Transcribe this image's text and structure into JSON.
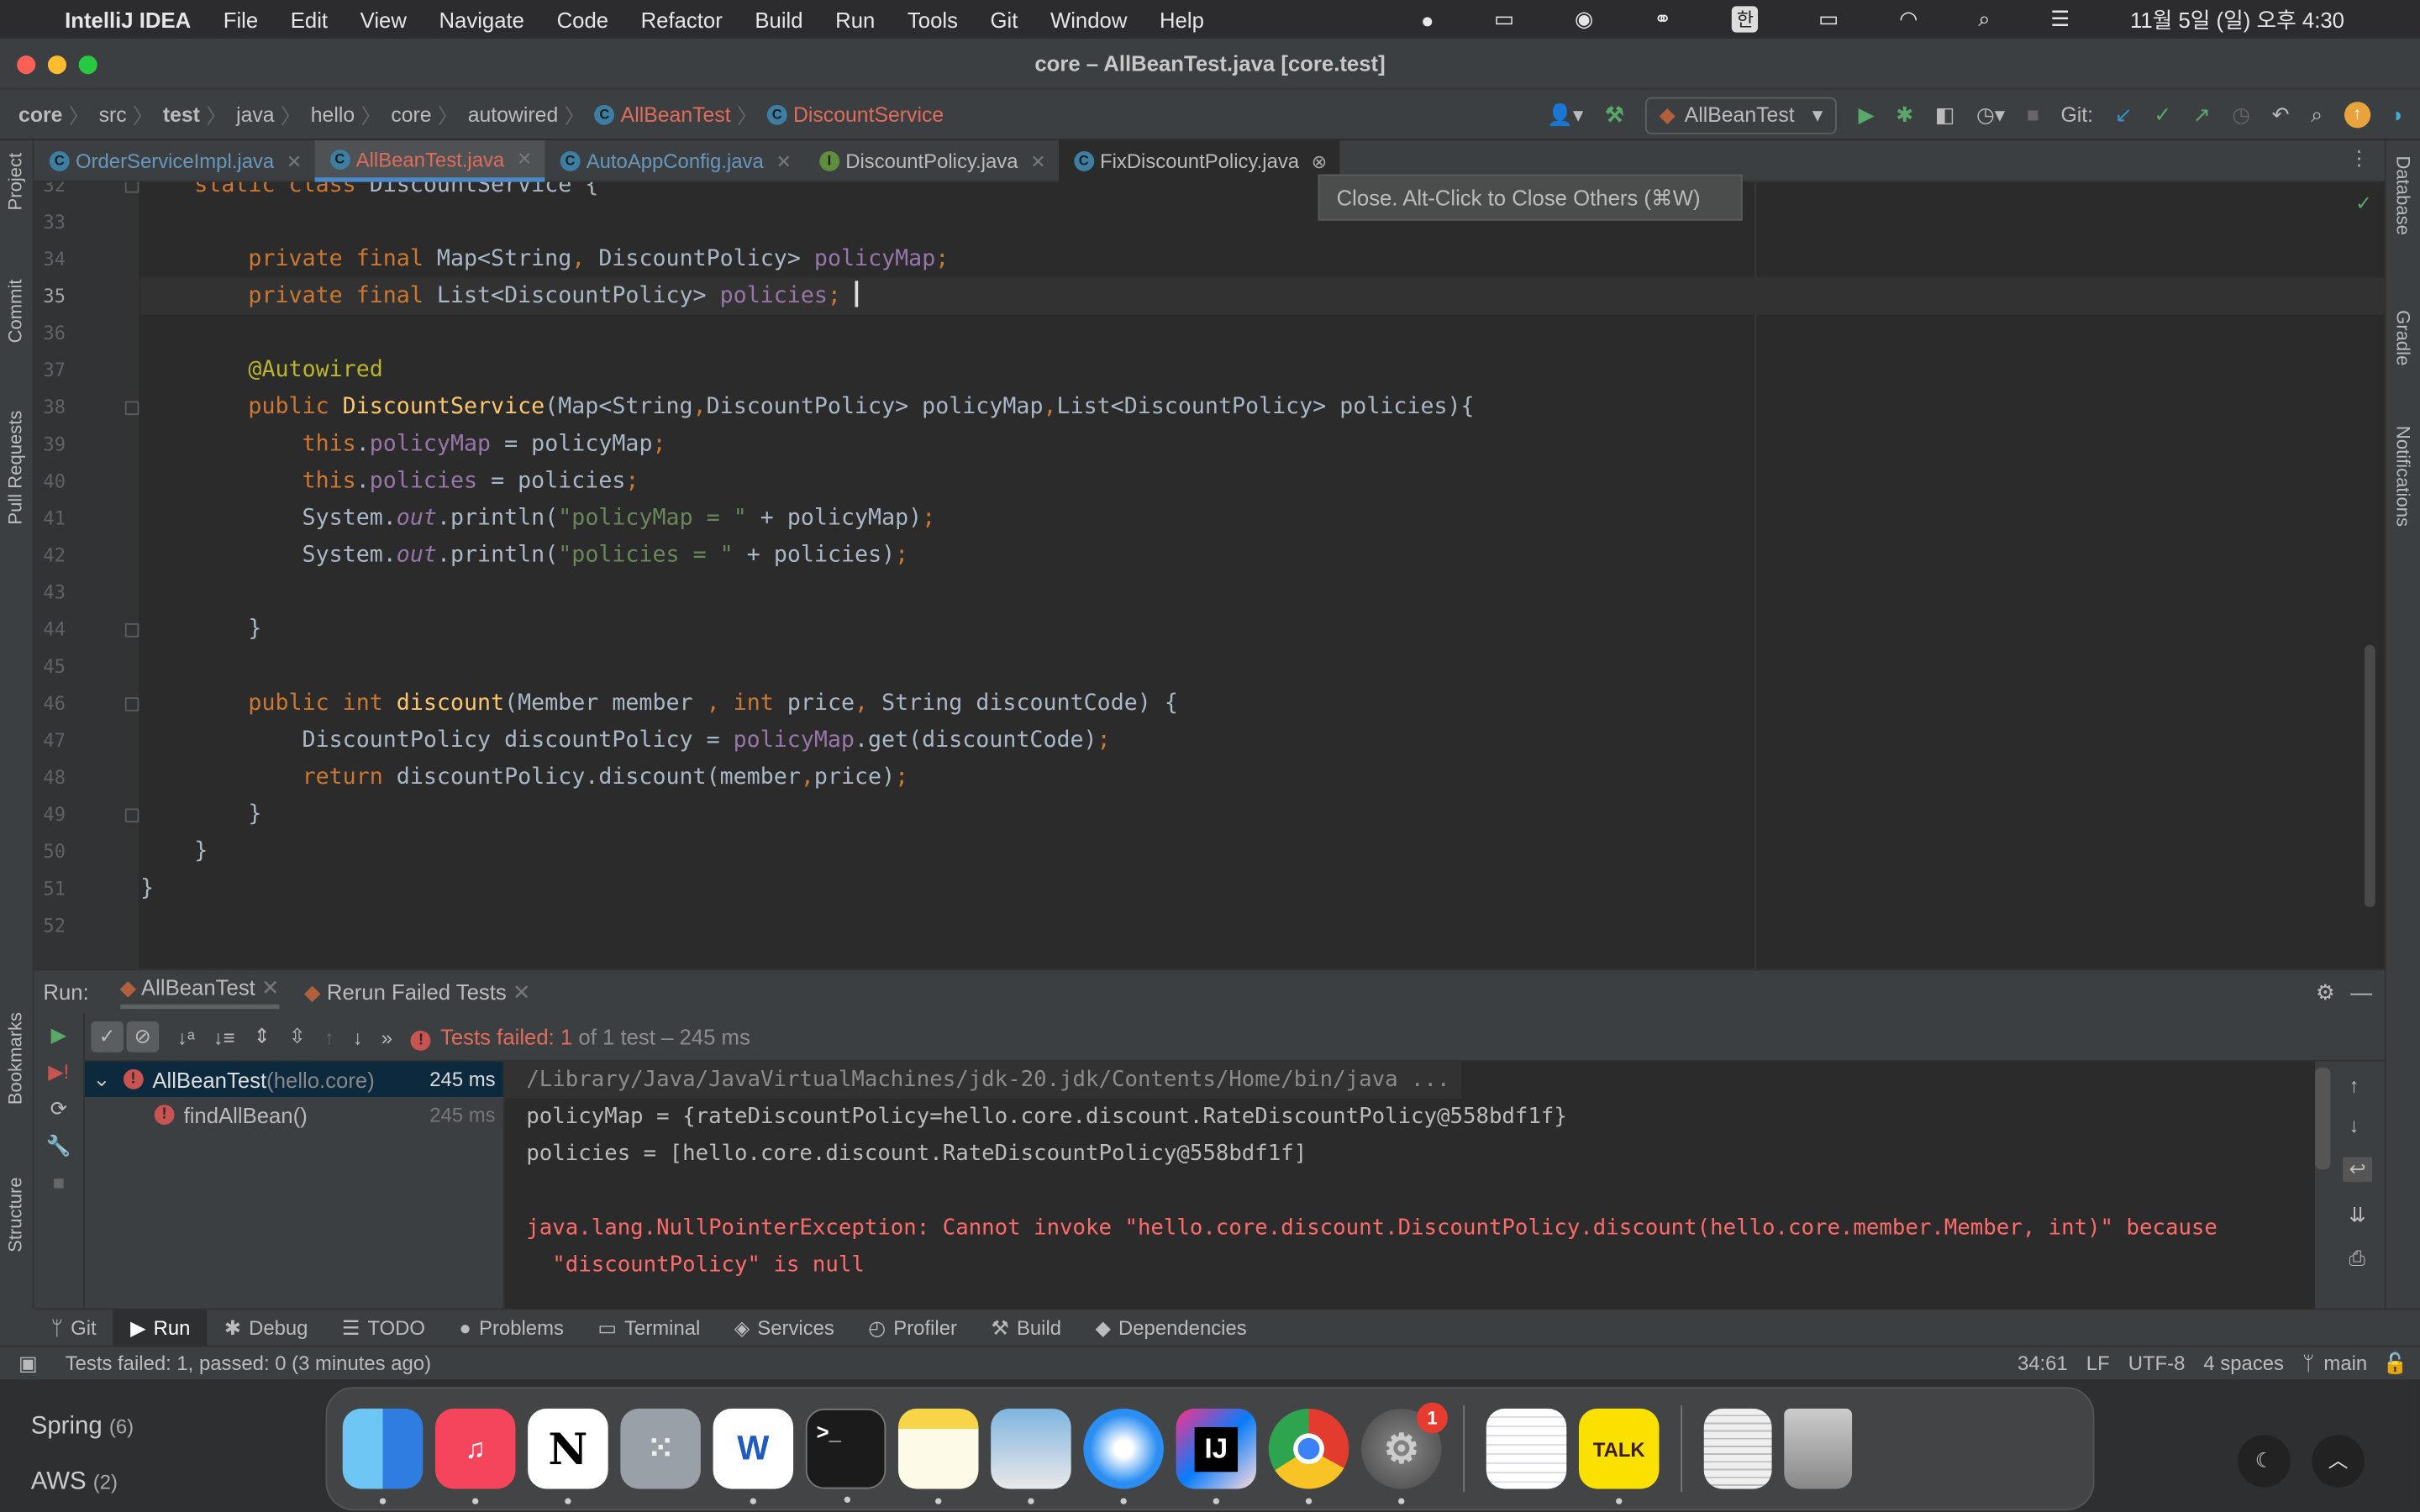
{
  "menubar": {
    "app": "IntelliJ IDEA",
    "items": [
      "File",
      "Edit",
      "View",
      "Navigate",
      "Code",
      "Refactor",
      "Build",
      "Run",
      "Tools",
      "Git",
      "Window",
      "Help"
    ],
    "ime": "한",
    "clock": "11월 5일 (일) 오후 4:30"
  },
  "window": {
    "title": "core – AllBeanTest.java [core.test]"
  },
  "breadcrumb": [
    "core",
    "src",
    "test",
    "java",
    "hello",
    "core",
    "autowired",
    "AllBeanTest",
    "DiscountService"
  ],
  "toolbar": {
    "run_config": "AllBeanTest",
    "git_label": "Git:"
  },
  "tabs": [
    {
      "label": "OrderServiceImpl.java",
      "icon": "class-icon"
    },
    {
      "label": "AllBeanTest.java",
      "icon": "class-icon",
      "active": true
    },
    {
      "label": "AutoAppConfig.java",
      "icon": "class-icon"
    },
    {
      "label": "DiscountPolicy.java",
      "icon": "interface-icon"
    },
    {
      "label": "FixDiscountPolicy.java",
      "icon": "class-icon"
    }
  ],
  "tooltip": "Close. Alt-Click to Close Others (⌘W)",
  "left_tools": [
    "Project",
    "Commit",
    "Pull Requests",
    "Bookmarks",
    "Structure"
  ],
  "right_tools": [
    "Database",
    "Gradle",
    "Notifications"
  ],
  "editor": {
    "current_line": 35,
    "lines": [
      {
        "n": 32,
        "t": [
          [
            "    "
          ],
          [
            "static class ",
            "k"
          ],
          [
            "DiscountService {"
          ]
        ]
      },
      {
        "n": 33,
        "t": []
      },
      {
        "n": 34,
        "t": [
          [
            "        "
          ],
          [
            "private final ",
            "k"
          ],
          [
            "Map<String"
          ],
          [
            ", ",
            "k"
          ],
          [
            "DiscountPolicy> "
          ],
          [
            "policyMap",
            "f"
          ],
          [
            ";",
            "k"
          ]
        ]
      },
      {
        "n": 35,
        "t": [
          [
            "        "
          ],
          [
            "private final ",
            "k"
          ],
          [
            "List<DiscountPolicy> "
          ],
          [
            "policies",
            "f"
          ],
          [
            ";",
            "k"
          ],
          [
            " "
          ]
        ]
      },
      {
        "n": 36,
        "t": []
      },
      {
        "n": 37,
        "t": [
          [
            "        "
          ],
          [
            "@Autowired",
            "a"
          ]
        ]
      },
      {
        "n": 38,
        "t": [
          [
            "        "
          ],
          [
            "public ",
            "k"
          ],
          [
            "DiscountService",
            "m"
          ],
          [
            "(Map<String"
          ],
          [
            ",",
            "k"
          ],
          [
            "DiscountPolicy> policyMap"
          ],
          [
            ",",
            "k"
          ],
          [
            "List<DiscountPolicy> policies){"
          ]
        ]
      },
      {
        "n": 39,
        "t": [
          [
            "            "
          ],
          [
            "this",
            "k"
          ],
          [
            "."
          ],
          [
            "policyMap",
            "f"
          ],
          [
            " = policyMap"
          ],
          [
            ";",
            "k"
          ]
        ]
      },
      {
        "n": 40,
        "t": [
          [
            "            "
          ],
          [
            "this",
            "k"
          ],
          [
            "."
          ],
          [
            "policies",
            "f"
          ],
          [
            " = policies"
          ],
          [
            ";",
            "k"
          ]
        ]
      },
      {
        "n": 41,
        "t": [
          [
            "            System."
          ],
          [
            "out",
            "o"
          ],
          [
            ".println("
          ],
          [
            "\"policyMap = \"",
            "s"
          ],
          [
            " + policyMap)"
          ],
          [
            ";",
            "k"
          ]
        ]
      },
      {
        "n": 42,
        "t": [
          [
            "            System."
          ],
          [
            "out",
            "o"
          ],
          [
            ".println("
          ],
          [
            "\"policies = \"",
            "s"
          ],
          [
            " + policies)"
          ],
          [
            ";",
            "k"
          ]
        ]
      },
      {
        "n": 43,
        "t": []
      },
      {
        "n": 44,
        "t": [
          [
            "        }"
          ]
        ]
      },
      {
        "n": 45,
        "t": []
      },
      {
        "n": 46,
        "t": [
          [
            "        "
          ],
          [
            "public int ",
            "k"
          ],
          [
            "discount",
            "m"
          ],
          [
            "(Member member "
          ],
          [
            ", ",
            "k"
          ],
          [
            "int ",
            "k"
          ],
          [
            "price"
          ],
          [
            ", ",
            "k"
          ],
          [
            "String discountCode) {"
          ]
        ]
      },
      {
        "n": 47,
        "t": [
          [
            "            DiscountPolicy discountPolicy = "
          ],
          [
            "policyMap",
            "f"
          ],
          [
            ".get(discountCode)"
          ],
          [
            ";",
            "k"
          ]
        ]
      },
      {
        "n": 48,
        "t": [
          [
            "            "
          ],
          [
            "return ",
            "k"
          ],
          [
            "discountPolicy.discount(member"
          ],
          [
            ",",
            "k"
          ],
          [
            "price)"
          ],
          [
            ";",
            "k"
          ]
        ]
      },
      {
        "n": 49,
        "t": [
          [
            "        }"
          ]
        ]
      },
      {
        "n": 50,
        "t": [
          [
            "    }"
          ]
        ]
      },
      {
        "n": 51,
        "t": [
          [
            "}"
          ]
        ]
      },
      {
        "n": 52,
        "t": []
      }
    ],
    "folds": [
      32,
      38,
      44,
      46,
      49
    ]
  },
  "run": {
    "label": "Run:",
    "tabs": [
      "AllBeanTest",
      "Rerun Failed Tests"
    ],
    "status_prefix": "Tests failed: ",
    "status_count": "1",
    "status_suffix": " of 1 test – 245 ms",
    "tree": [
      {
        "name": "AllBeanTest",
        "pkg": " (hello.core)",
        "time": "245 ms",
        "selected": true
      },
      {
        "name": "findAllBean()",
        "time": "245 ms"
      }
    ],
    "console": [
      {
        "text": "/Library/Java/JavaVirtualMachines/jdk-20.jdk/Contents/Home/bin/java ...",
        "kind": "gray"
      },
      {
        "text": "policyMap = {rateDiscountPolicy=hello.core.discount.RateDiscountPolicy@558bdf1f}",
        "kind": "plain"
      },
      {
        "text": "policies = [hello.core.discount.RateDiscountPolicy@558bdf1f]",
        "kind": "plain"
      },
      {
        "text": "",
        "kind": "plain"
      },
      {
        "text": "java.lang.NullPointerException: Cannot invoke \"hello.core.discount.DiscountPolicy.discount(hello.core.member.Member, int)\" because",
        "kind": "err"
      },
      {
        "text": "  \"discountPolicy\" is null",
        "kind": "err"
      }
    ]
  },
  "bottom_tabs": [
    "Git",
    "Run",
    "Debug",
    "TODO",
    "Problems",
    "Terminal",
    "Services",
    "Profiler",
    "Build",
    "Dependencies"
  ],
  "status": {
    "message": "Tests failed: 1, passed: 0 (3 minutes ago)",
    "position": "34:61",
    "line_sep": "LF",
    "encoding": "UTF-8",
    "indent": "4 spaces",
    "branch": "main"
  },
  "desktop": {
    "groups": [
      {
        "name": "Spring",
        "count": "(6)"
      },
      {
        "name": "AWS",
        "count": "(2)"
      }
    ]
  },
  "dock": {
    "apps": [
      "Finder",
      "Music",
      "Notion",
      "Launchpad",
      "Word",
      "Terminal",
      "Notes",
      "Preview",
      "Safari",
      "IntelliJ IDEA",
      "Chrome",
      "System Settings",
      "TextEdit",
      "KakaoTalk",
      "Document",
      "Trash"
    ],
    "settings_badge": "1",
    "kakao_label": "TALK"
  }
}
